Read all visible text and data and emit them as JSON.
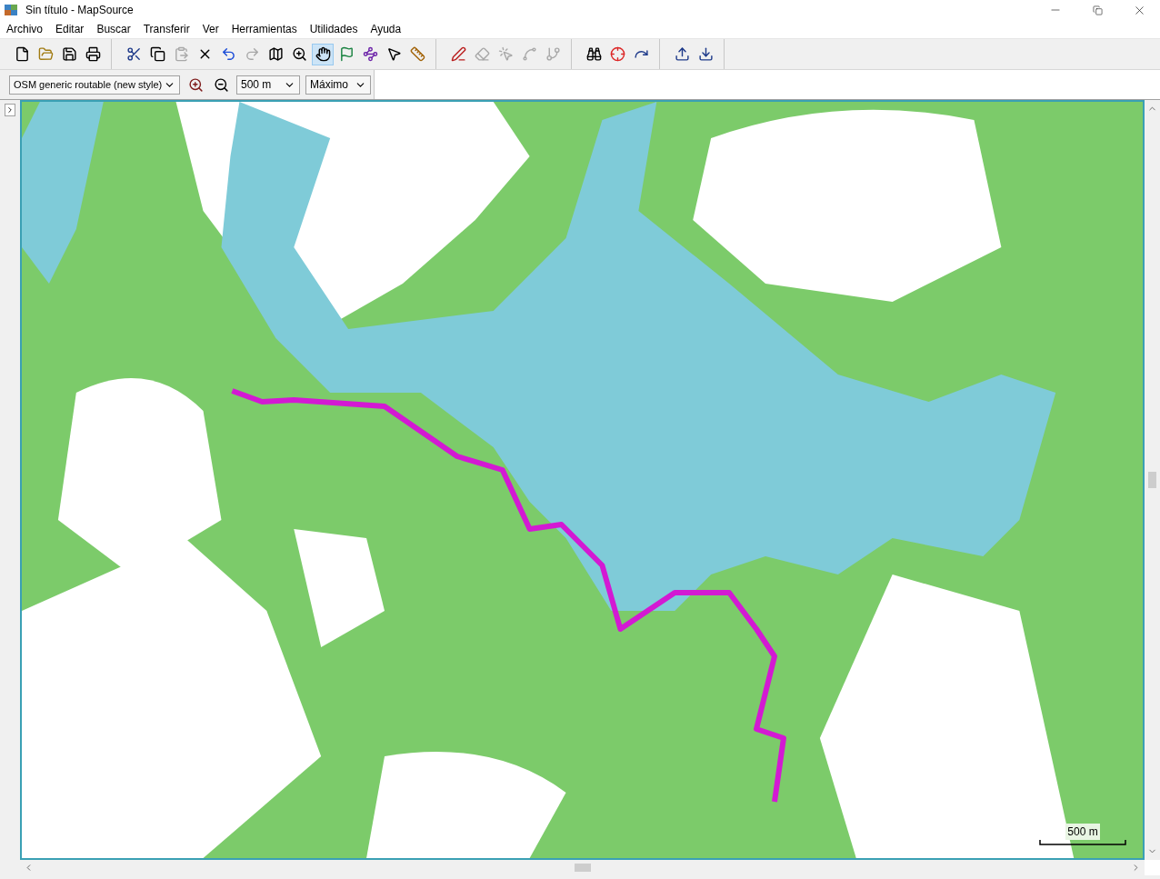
{
  "window": {
    "title": "Sin título - MapSource"
  },
  "menu": [
    "Archivo",
    "Editar",
    "Buscar",
    "Transferir",
    "Ver",
    "Herramientas",
    "Utilidades",
    "Ayuda"
  ],
  "toolbar": [
    [
      {
        "kind": "new",
        "disabled": false,
        "selected": false
      },
      {
        "kind": "open",
        "disabled": false,
        "selected": false
      },
      {
        "kind": "save",
        "disabled": false,
        "selected": false
      },
      {
        "kind": "print",
        "disabled": false,
        "selected": false
      }
    ],
    [
      {
        "kind": "cut",
        "disabled": false,
        "selected": false
      },
      {
        "kind": "copy",
        "disabled": false,
        "selected": false
      },
      {
        "kind": "paste",
        "disabled": true,
        "selected": false
      },
      {
        "kind": "delete",
        "disabled": false,
        "selected": false
      },
      {
        "kind": "undo",
        "disabled": false,
        "selected": false
      },
      {
        "kind": "redo",
        "disabled": true,
        "selected": false
      },
      {
        "kind": "map",
        "disabled": false,
        "selected": false
      },
      {
        "kind": "zoom",
        "disabled": false,
        "selected": false
      },
      {
        "kind": "hand",
        "disabled": false,
        "selected": true
      },
      {
        "kind": "flag",
        "disabled": false,
        "selected": false
      },
      {
        "kind": "route",
        "disabled": false,
        "selected": false
      },
      {
        "kind": "pointer",
        "disabled": false,
        "selected": false
      },
      {
        "kind": "ruler",
        "disabled": false,
        "selected": false
      }
    ],
    [
      {
        "kind": "track-edit",
        "disabled": false,
        "selected": false
      },
      {
        "kind": "eraser",
        "disabled": true,
        "selected": false
      },
      {
        "kind": "select",
        "disabled": true,
        "selected": false
      },
      {
        "kind": "route-insert",
        "disabled": true,
        "selected": false
      },
      {
        "kind": "route-split",
        "disabled": true,
        "selected": false
      }
    ],
    [
      {
        "kind": "find",
        "disabled": false,
        "selected": false
      },
      {
        "kind": "find-target",
        "disabled": false,
        "selected": false
      },
      {
        "kind": "find-next",
        "disabled": false,
        "selected": false
      }
    ],
    [
      {
        "kind": "send",
        "disabled": false,
        "selected": false
      },
      {
        "kind": "receive",
        "disabled": false,
        "selected": false
      }
    ]
  ],
  "map_toolbar": {
    "product": "OSM generic routable (new style)",
    "zoom": "500 m",
    "detail": "Máximo"
  },
  "map": {
    "kind": "picture",
    "scale_label": "500 m"
  }
}
